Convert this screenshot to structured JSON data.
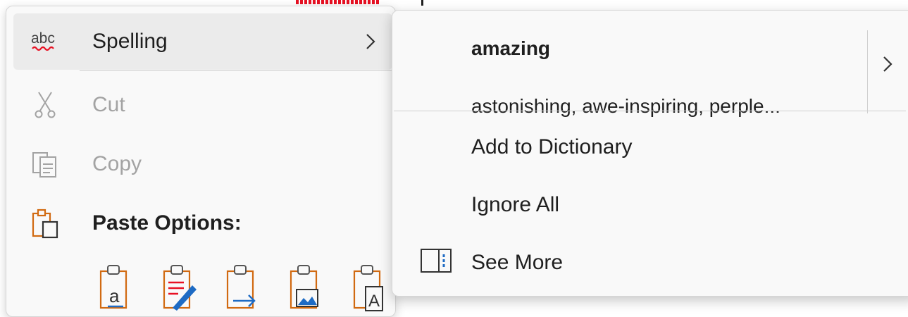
{
  "menu": {
    "spelling_label": "Spelling",
    "cut_label": "Cut",
    "copy_label": "Copy",
    "paste_options_label": "Paste Options:",
    "paste_buttons": [
      "keep-source-formatting",
      "merge-formatting",
      "keep-text-only",
      "picture",
      "text"
    ]
  },
  "submenu": {
    "synonym_word": "amazing",
    "synonym_list": "astonishing, awe-inspiring, perple...",
    "add_to_dictionary_label": "Add to Dictionary",
    "ignore_all_label": "Ignore All",
    "see_more_label": "See More"
  },
  "icons": {
    "spelling": "abc-spelling-icon",
    "cut": "scissors-icon",
    "copy": "copy-icon",
    "paste": "clipboard-icon",
    "see_more": "reading-pane-icon"
  },
  "colors": {
    "menu_background": "#f9f9f9",
    "hover_background": "#ebebeb",
    "disabled_text": "#a3a3a3",
    "accent_orange": "#d16a11",
    "squiggle_red": "#e81123",
    "accent_blue": "#1e6bc4"
  }
}
